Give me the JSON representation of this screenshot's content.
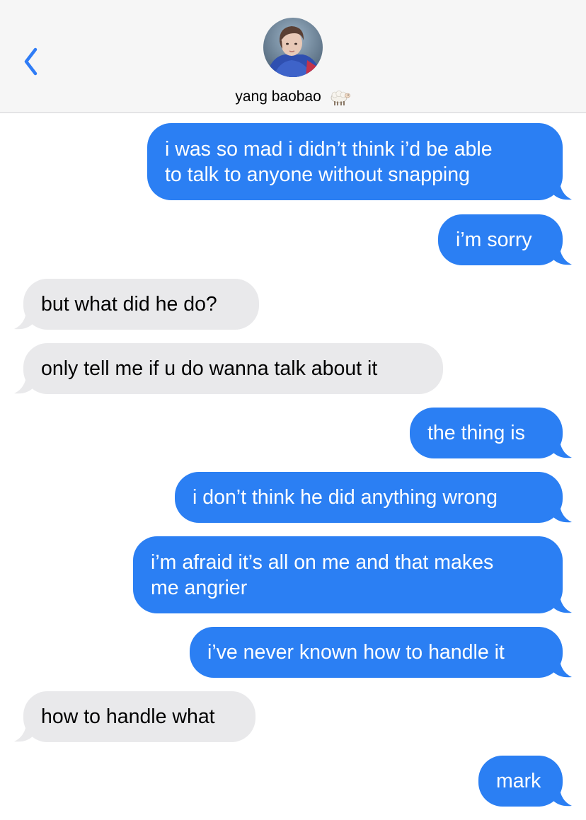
{
  "header": {
    "contact_name": "yang baobao",
    "contact_emoji_icon": "sheep-icon",
    "back_icon": "chevron-left-icon",
    "avatar_icon": "contact-avatar"
  },
  "colors": {
    "sent_bubble": "#2b7ff3",
    "received_bubble": "#e9e9eb",
    "accent": "#2f7cf6",
    "header_bg": "#f6f6f6"
  },
  "messages": [
    {
      "direction": "sent",
      "text": "i was so mad i didn’t think i’d be able\nto talk to anyone without snapping"
    },
    {
      "direction": "sent",
      "text": "i’m sorry"
    },
    {
      "direction": "received",
      "text": "but what did he do?"
    },
    {
      "direction": "received",
      "text": "only tell me if u do wanna talk about it"
    },
    {
      "direction": "sent",
      "text": "the thing is"
    },
    {
      "direction": "sent",
      "text": "i don’t think he did anything wrong"
    },
    {
      "direction": "sent",
      "text": "i’m afraid it’s all on me and that makes\nme angrier"
    },
    {
      "direction": "sent",
      "text": "i’ve never known how to handle it"
    },
    {
      "direction": "received",
      "text": "how to handle what"
    },
    {
      "direction": "sent",
      "text": "mark"
    }
  ]
}
